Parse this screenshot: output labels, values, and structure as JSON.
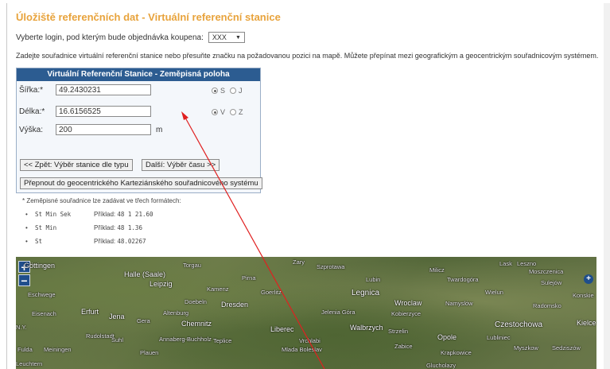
{
  "page_title": "Úložiště referenčních dat - Virtuální referenční stanice",
  "login": {
    "label": "Vyberte login, pod kterým bude objednávka koupena:",
    "value": "XXX"
  },
  "instruction": "Zadejte souřadnice virtuální referenční stanice nebo přesuňte značku na požadovanou pozici na mapě. Můžete přepínat mezi geografickým a geocentrickým souřadnicovým systémem.",
  "panel": {
    "header": "Virtuální Referenční Stanice - Zeměpisná poloha",
    "latitude": {
      "label": "Šířka:*",
      "value": "49.2430231",
      "opt1": "S",
      "opt2": "J",
      "selected": "S"
    },
    "longitude": {
      "label": "Délka:*",
      "value": "16.6156525",
      "opt1": "V",
      "opt2": "Z",
      "selected": "V"
    },
    "height": {
      "label": "Výška:",
      "value": "200",
      "unit": "m"
    },
    "back_button": "<< Zpět: Výběr stanice dle typu",
    "next_button": "Další: Výběr času >>",
    "switch_button": "Přepnout do geocentrického Karteziánského souřadnicového systému"
  },
  "formats": {
    "hint": "* Zeměpisné souřadnice lze zadávat ve třech formátech:",
    "example_label": "Příklad:",
    "rows": [
      {
        "code": "St Min Sek",
        "example": "48 1 21.60"
      },
      {
        "code": "St Min",
        "example": "48 1.36"
      },
      {
        "code": "St",
        "example": "48.02267"
      }
    ]
  },
  "map": {
    "zoom_in": "+",
    "zoom_out": "−",
    "layers": "+",
    "labels": [
      "Göttingen",
      "Halle (Saale)",
      "Torgau",
      "Leipzig",
      "Eschwege",
      "Kamenz",
      "Doebeln",
      "Dresden",
      "Eisenach",
      "Erfurt",
      "Jena",
      "Gera",
      "Altenburg",
      "Chemnitz",
      "Rudolstadt",
      "Annaberg-Buchholz",
      "Plauen",
      "Meiningen",
      "Fulda",
      "Suhl",
      "Teplice",
      "Liberec",
      "Jelenia Góra",
      "Legnica",
      "Lubin",
      "Zary",
      "Szprotawa",
      "Milicz",
      "Twardogóra",
      "Wroclaw",
      "Namyslów",
      "Kobierzyce",
      "Walbrzych",
      "Strzelin",
      "Opole",
      "Lubliniec",
      "Czestochowa",
      "Wielun",
      "Radomsko",
      "Leszno",
      "Moszczenica",
      "Sulejów",
      "Konskie",
      "Kielce",
      "Mlada Boleslav",
      "Vrchlabi",
      "Zabice",
      "Myszkow",
      "Sedziszów",
      "Krapkowice",
      "Lask",
      "Goerlitz",
      "Glucholazy",
      "N.Y.",
      "Pirna",
      "Leuchtern"
    ]
  },
  "colors": {
    "title": "#e8a33c",
    "panel_header": "#2c5c91",
    "arrow": "#e02020"
  }
}
